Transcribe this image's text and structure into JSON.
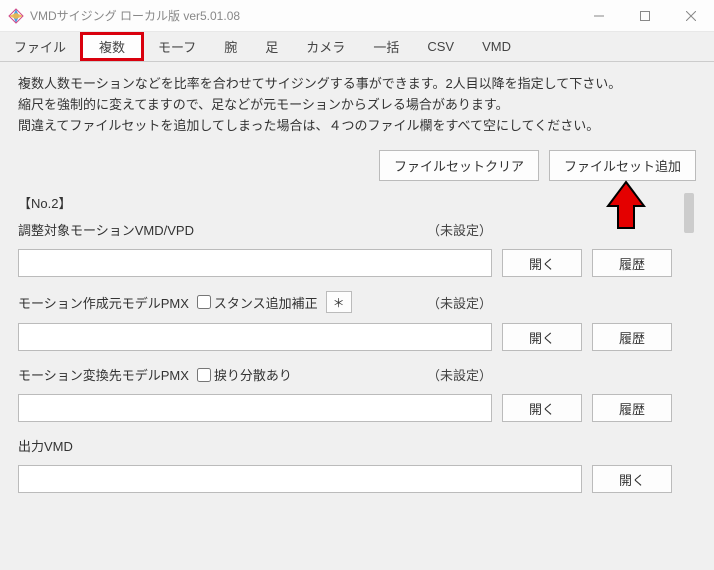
{
  "window": {
    "title": "VMDサイジング ローカル版 ver5.01.08"
  },
  "tabs": {
    "items": [
      {
        "label": "ファイル"
      },
      {
        "label": "複数"
      },
      {
        "label": "モーフ"
      },
      {
        "label": "腕"
      },
      {
        "label": "足"
      },
      {
        "label": "カメラ"
      },
      {
        "label": "一括"
      },
      {
        "label": "CSV"
      },
      {
        "label": "VMD"
      }
    ]
  },
  "intro": {
    "line1": "複数人数モーションなどを比率を合わせてサイジングする事ができます。2人目以降を指定して下さい。",
    "line2": "縮尺を強制的に変えてますので、足などが元モーションからズレる場合があります。",
    "line3": "間違えてファイルセットを追加してしまった場合は、４つのファイル欄をすべて空にしてください。"
  },
  "actions": {
    "clear_set": "ファイルセットクリア",
    "add_set": "ファイルセット追加"
  },
  "section": {
    "title": "【No.2】",
    "unset": "（未設定）",
    "open_label": "開く",
    "history_label": "履歴",
    "star": "＊",
    "field1": {
      "label": "調整対象モーションVMD/VPD",
      "value": ""
    },
    "field2": {
      "label": "モーション作成元モデルPMX",
      "chk_label": "スタンス追加補正",
      "value": ""
    },
    "field3": {
      "label": "モーション変換先モデルPMX",
      "chk_label": "捩り分散あり",
      "value": ""
    },
    "field4": {
      "label": "出力VMD",
      "value": ""
    }
  }
}
